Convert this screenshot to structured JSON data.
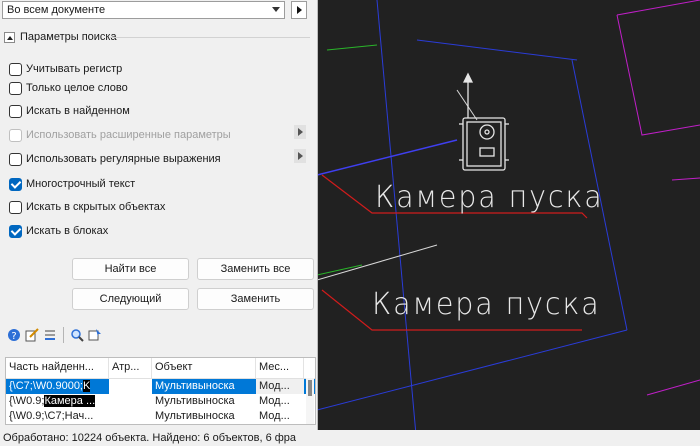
{
  "search": {
    "scope_value": "Во всем документе"
  },
  "section": {
    "title": "Параметры поиска"
  },
  "options": [
    {
      "label": "Учитывать регистр",
      "checked": false
    },
    {
      "label": "Только целое слово",
      "checked": false
    },
    {
      "label": "Искать в найденном",
      "checked": false
    },
    {
      "label": "Использовать расширенные параметры",
      "checked": false,
      "disabled": true
    },
    {
      "label": "Использовать регулярные выражения",
      "checked": false
    },
    {
      "label": "Многострочный текст",
      "checked": true
    },
    {
      "label": "Искать в скрытых объектах",
      "checked": false
    },
    {
      "label": "Искать в блоках",
      "checked": true
    }
  ],
  "buttons": {
    "find_all": "Найти все",
    "replace_all": "Заменить все",
    "next": "Следующий",
    "replace": "Заменить"
  },
  "results": {
    "columns": [
      "Часть найденн...",
      "Атр...",
      "Объект",
      "Мес..."
    ],
    "rows": [
      {
        "part": "{\\C7;\\W0.9000;",
        "part_hl": "K",
        "attr": "",
        "object": "Мультивыноска",
        "place": "Мод..."
      },
      {
        "part": "{\\W0.9;",
        "part_hl": "Камера ...",
        "attr": "",
        "object": "Мультивыноска",
        "place": "Мод..."
      },
      {
        "part": "{\\W0.9;\\C7;Нач...",
        "part_hl": "",
        "attr": "",
        "object": "Мультивыноска",
        "place": "Мод..."
      }
    ]
  },
  "status": "Обработано: 10224 объекта. Найдено: 6 объектов, 6 фра",
  "canvas": {
    "label1": "Камера пуска",
    "label2": "Камера пуска"
  },
  "colors": {
    "accent": "#0078d7",
    "cad_bg": "#212121",
    "cad_red": "#d01c1c",
    "cad_magenta": "#c01fc8",
    "cad_blue": "#2a2ae0"
  }
}
